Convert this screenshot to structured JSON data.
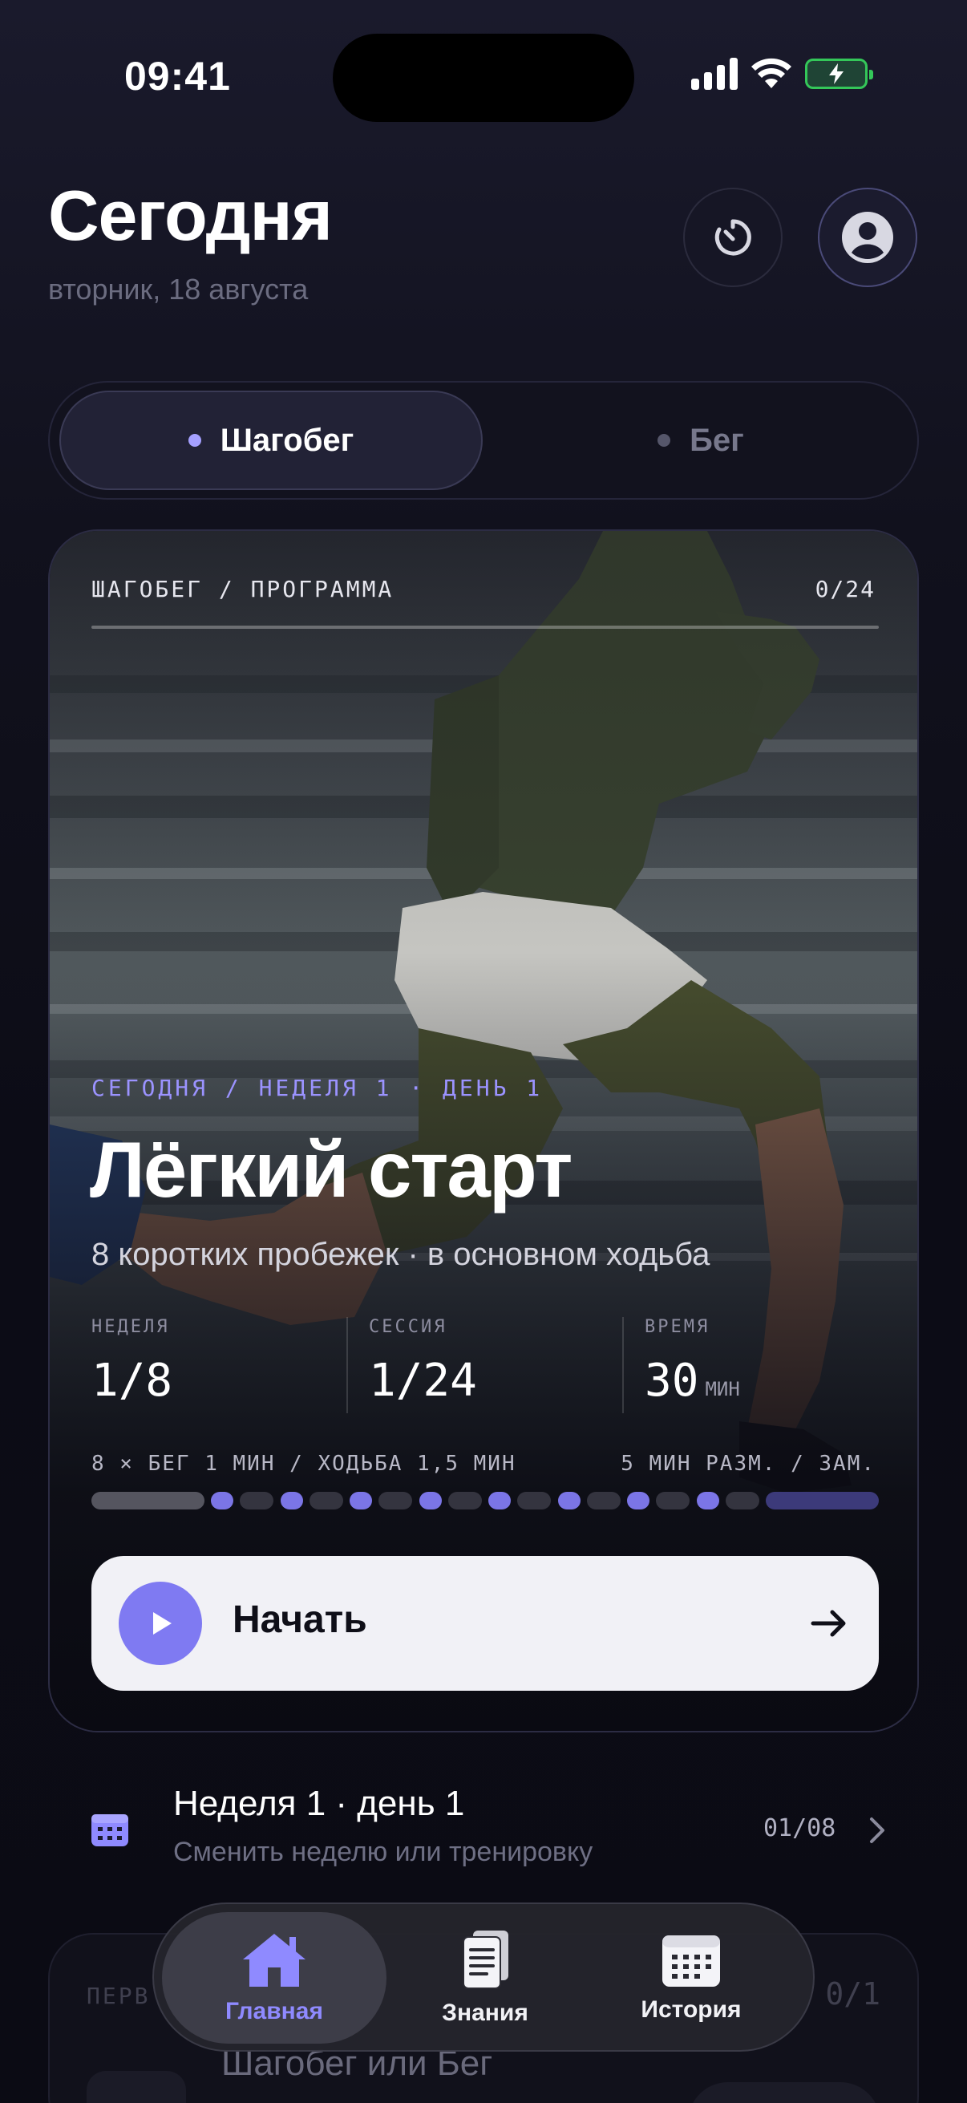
{
  "status_bar": {
    "time": "09:41"
  },
  "header": {
    "title": "Сегодня",
    "date": "вторник, 18 августа"
  },
  "segmented": {
    "options": [
      {
        "label": "Шагобег",
        "active": true
      },
      {
        "label": "Бег",
        "active": false
      }
    ]
  },
  "program_card": {
    "label": "ШАГОБЕГ / ПРОГРАММА",
    "progress": "0/24",
    "today_label": "СЕГОДНЯ / НЕДЕЛЯ 1 · ДЕНЬ 1",
    "title": "Лёгкий старт",
    "subtitle": "8 коротких пробежек · в основном ходьба",
    "stats": [
      {
        "key": "НЕДЕЛЯ",
        "value": "1/8",
        "unit": ""
      },
      {
        "key": "СЕССИЯ",
        "value": "1/24",
        "unit": ""
      },
      {
        "key": "ВРЕМЯ",
        "value": "30",
        "unit": "МИН"
      }
    ],
    "plan_left": "8 × БЕГ 1 МИН / ХОДЬБА 1,5 МИН",
    "plan_right": "5 МИН РАЗМ. / ЗАМ.",
    "start_label": "Начать",
    "colors": {
      "accent": "#7f7af2",
      "run": "#7b75e6",
      "walk": "#34343f",
      "warm": "#55555f",
      "cool": "#3c3a7a"
    }
  },
  "week_row": {
    "title": "Неделя 1 · день 1",
    "subtitle": "Сменить неделю или тренировку",
    "count": "01/08"
  },
  "secondary_card": {
    "label": "ПЕРВ",
    "count": "0/1",
    "title": "Шагобег или Бег"
  },
  "tab_bar": {
    "items": [
      {
        "label": "Главная",
        "icon": "home-icon",
        "active": true
      },
      {
        "label": "Знания",
        "icon": "document-icon",
        "active": false
      },
      {
        "label": "История",
        "icon": "calendar-icon",
        "active": false
      }
    ]
  }
}
